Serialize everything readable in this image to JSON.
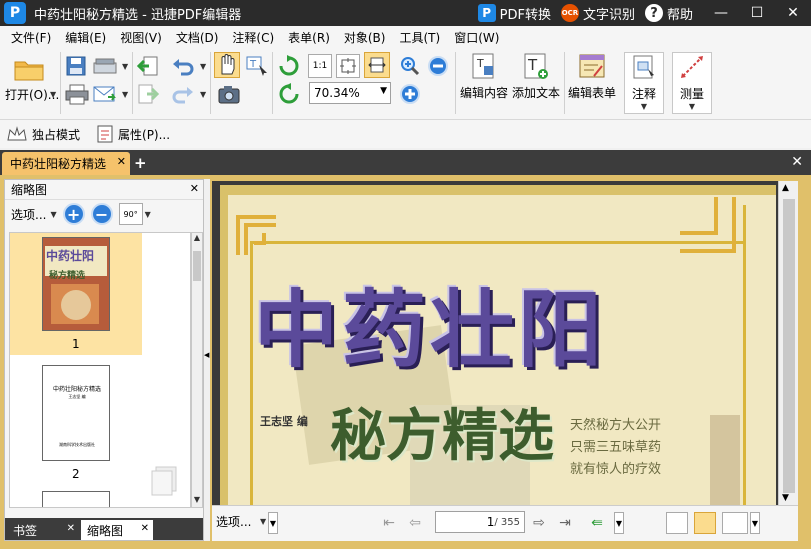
{
  "window": {
    "title": "中药壮阳秘方精选 - 迅捷PDF编辑器",
    "logo_letter": "P",
    "links": {
      "pdf_convert": "PDF转换",
      "ocr_badge": "OCR",
      "ocr": "文字识别",
      "help_glyph": "?",
      "help": "帮助"
    },
    "controls": {
      "minimize": "—",
      "maximize": "☐",
      "close": "✕"
    }
  },
  "menu": [
    "文件(F)",
    "编辑(E)",
    "视图(V)",
    "文档(D)",
    "注释(C)",
    "表单(R)",
    "对象(B)",
    "工具(T)",
    "窗口(W)"
  ],
  "toolbar": {
    "open_label": "打开(O)...",
    "zoom_value": "70.34%",
    "fit_actual_label": "1:1",
    "edit_content": "编辑内容",
    "add_text": "添加文本",
    "edit_form": "编辑表单",
    "annotate": "注释",
    "measure": "测量"
  },
  "mode_row": {
    "exclusive_mode": "独占模式",
    "properties": "属性(P)..."
  },
  "tabs": {
    "active_doc": "中药壮阳秘方精选",
    "close_glyph": "✕",
    "add_glyph": "+"
  },
  "left_panel": {
    "title": "缩略图",
    "options": "选项...",
    "rotate_label": "90°",
    "pages": [
      {
        "number": "1",
        "thumb_title": "中药壮阳",
        "thumb_sub": "秘方精选"
      },
      {
        "number": "2",
        "thumb_title": "中药壮阳秘方精选",
        "thumb_author": "王志坚 编",
        "thumb_publisher": "湖南科学技术出版社"
      }
    ],
    "bottom_tabs": [
      "书签",
      "缩略图"
    ]
  },
  "document": {
    "cover_title": "中药壮阳",
    "cover_sub": "秘方精选",
    "cover_author": "王志坚 编",
    "cover_slogan": [
      "天然秘方大公开",
      "只需三五味草药",
      "就有惊人的疗效"
    ]
  },
  "doc_bar": {
    "options": "选项...",
    "current_page": "1",
    "total_pages": "/ 355"
  },
  "colors": {
    "titlebar": "#2b2b2b",
    "tab_active": "#f5c26b",
    "accent_blue": "#1e88e5",
    "cover_title": "#5b4a9a"
  }
}
